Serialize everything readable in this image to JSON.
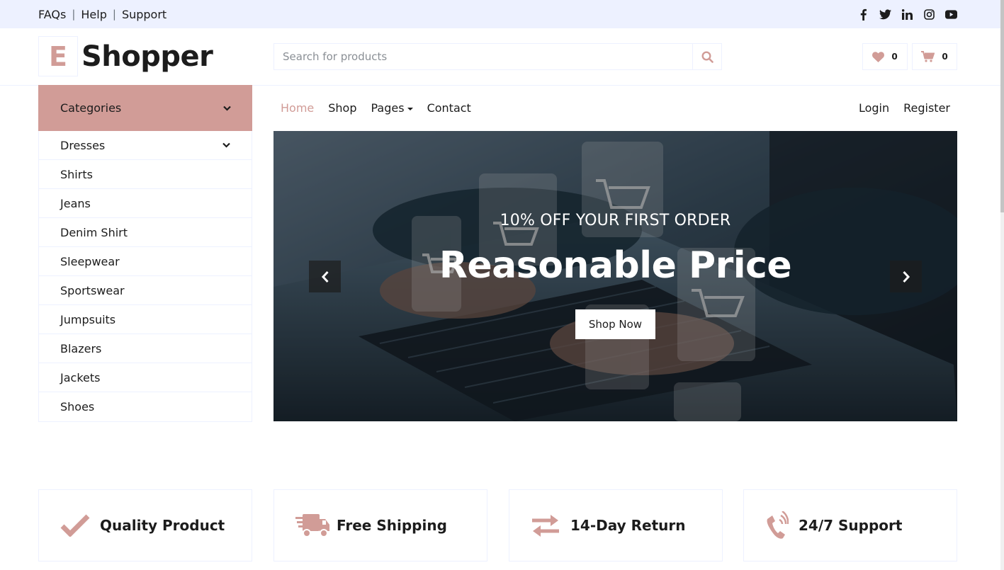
{
  "topbar": {
    "links": [
      "FAQs",
      "Help",
      "Support"
    ],
    "social_icons": [
      "facebook-icon",
      "twitter-icon",
      "linkedin-icon",
      "instagram-icon",
      "youtube-icon"
    ]
  },
  "header": {
    "logo_letter": "E",
    "logo_name": "Shopper",
    "search_placeholder": "Search for products",
    "wishlist_count": "0",
    "cart_count": "0"
  },
  "sidebar": {
    "title": "Categories",
    "items": [
      "Dresses",
      "Shirts",
      "Jeans",
      "Denim Shirt",
      "Sleepwear",
      "Sportswear",
      "Jumpsuits",
      "Blazers",
      "Jackets",
      "Shoes"
    ]
  },
  "nav": {
    "home": "Home",
    "shop": "Shop",
    "pages": "Pages",
    "contact": "Contact",
    "login": "Login",
    "register": "Register"
  },
  "hero": {
    "subtitle": "10% OFF YOUR FIRST ORDER",
    "title": "Reasonable Price",
    "button": "Shop Now"
  },
  "features": [
    "Quality Product",
    "Free Shipping",
    "14-Day Return",
    "24/7 Support"
  ],
  "colors": {
    "primary": "#D19C97",
    "secondary": "#EDF1FF",
    "dark": "#1C1C1C"
  }
}
